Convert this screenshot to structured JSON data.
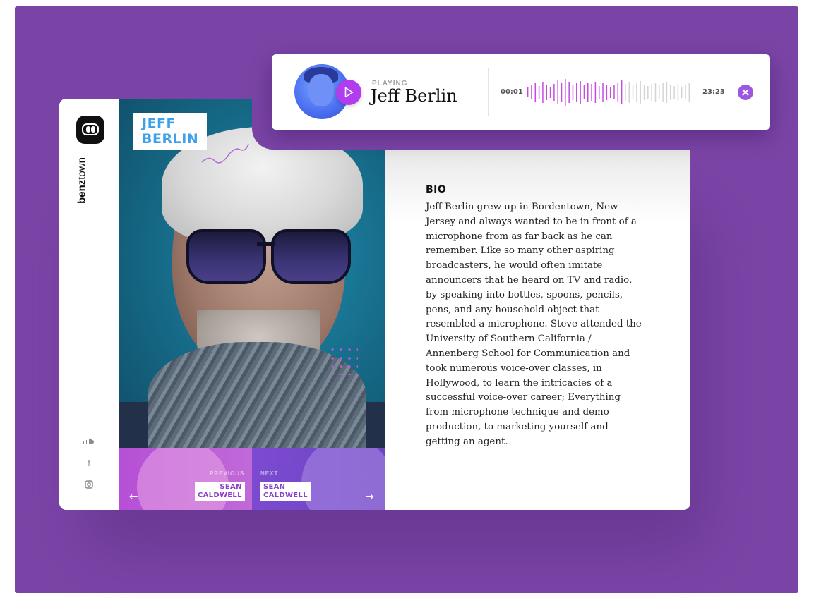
{
  "brand": {
    "prefix": "benz",
    "suffix": "town"
  },
  "profile": {
    "first_name": "JEFF",
    "last_name": "BERLIN"
  },
  "navigation": {
    "previous": {
      "label": "PREVIOUS",
      "first": "SEAN",
      "last": "CALDWELL",
      "arrow": "←"
    },
    "next": {
      "label": "NEXT",
      "first": "SEAN",
      "last": "CALDWELL",
      "arrow": "→"
    }
  },
  "bio": {
    "title": "BIO",
    "text": "Jeff Berlin grew up in Bordentown, New Jersey and always wanted to be in front of a microphone from as far back as he can remember. Like so many other aspiring broadcasters, he would often imitate announcers that he heard on TV and radio, by speaking into bottles, spoons, pencils, pens, and any household object that resembled a microphone. Steve attended the University of Southern California / Annenberg School for Communication and took numerous voice-over classes, in Hollywood, to learn the intricacies of a successful voice-over career; Everything from microphone technique and demo production, to marketing yourself and getting an agent."
  },
  "player": {
    "status_label": "PLAYING",
    "track_name": "Jeff Berlin",
    "current_time": "00:01",
    "total_time": "23:23",
    "progress_fraction": 0.6
  },
  "social": [
    {
      "icon": "soundcloud-icon",
      "glyph": "☁"
    },
    {
      "icon": "facebook-icon",
      "glyph": "f"
    },
    {
      "icon": "instagram-icon",
      "glyph": "◎"
    }
  ],
  "colors": {
    "background": "#7a44a6",
    "accent": "#b13cf0",
    "name_blue": "#3da0e8",
    "wave_active": "#c64ae0",
    "wave_inactive": "#d4d4d4"
  }
}
